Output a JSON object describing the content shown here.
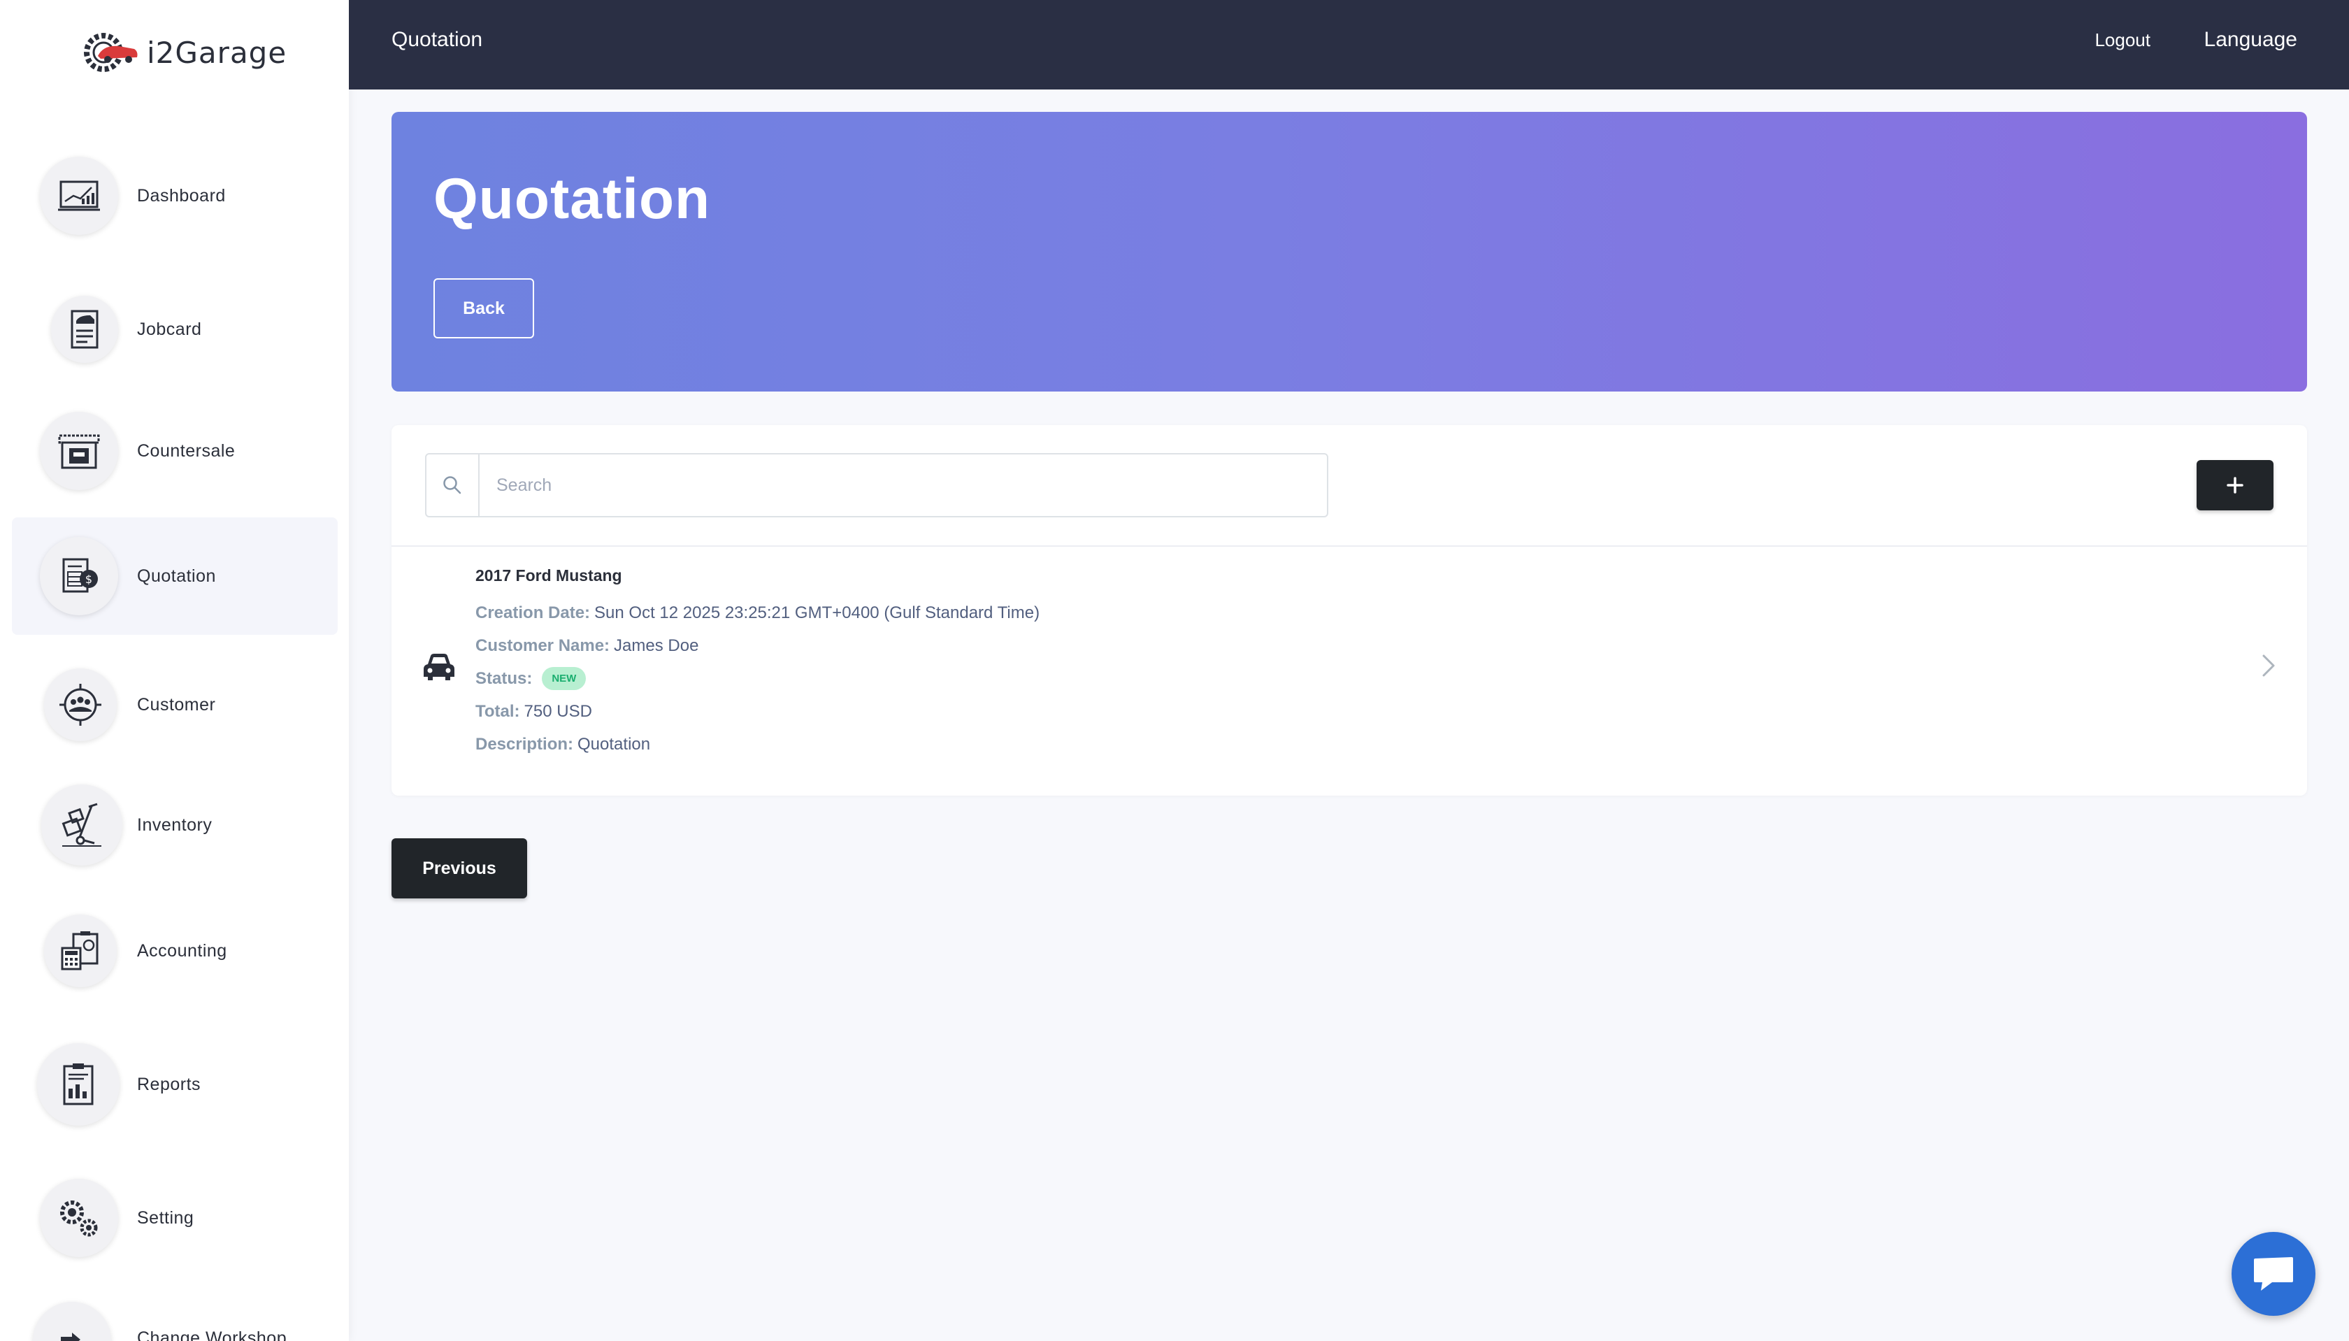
{
  "brand": {
    "name": "i2Garage"
  },
  "sidebar": {
    "items": [
      {
        "label": "Dashboard",
        "icon": "dashboard-chart-icon"
      },
      {
        "label": "Jobcard",
        "icon": "jobcard-icon"
      },
      {
        "label": "Countersale",
        "icon": "shop-counter-icon"
      },
      {
        "label": "Quotation",
        "icon": "quotation-document-icon",
        "active": true
      },
      {
        "label": "Customer",
        "icon": "customer-group-icon"
      },
      {
        "label": "Inventory",
        "icon": "hand-truck-icon"
      },
      {
        "label": "Accounting",
        "icon": "calculator-clipboard-icon"
      },
      {
        "label": "Reports",
        "icon": "report-clipboard-icon"
      },
      {
        "label": "Setting",
        "icon": "gears-icon"
      },
      {
        "label": "Change Workshop",
        "icon": "change-workshop-icon"
      }
    ]
  },
  "topbar": {
    "title": "Quotation",
    "logout": "Logout",
    "language": "Language"
  },
  "hero": {
    "title": "Quotation",
    "back_label": "Back"
  },
  "search": {
    "placeholder": "Search",
    "value": ""
  },
  "quotations": [
    {
      "title": "2017 Ford Mustang",
      "creation_date_label": "Creation Date:",
      "creation_date": "Sun Oct 12 2025 23:25:21 GMT+0400 (Gulf Standard Time)",
      "customer_label": "Customer Name:",
      "customer": "James Doe",
      "status_label": "Status:",
      "status": "NEW",
      "total_label": "Total:",
      "total": "750 USD",
      "description_label": "Description:",
      "description": "Quotation"
    }
  ],
  "pagination": {
    "previous_label": "Previous"
  },
  "colors": {
    "topbar": "#2a2f44",
    "hero_start": "#6e82e0",
    "hero_end": "#8a6ee0",
    "dark_button": "#212529",
    "status_new_bg": "#b8efd1",
    "status_new_text": "#1aae6f",
    "chat_button": "#2c6fd6"
  }
}
